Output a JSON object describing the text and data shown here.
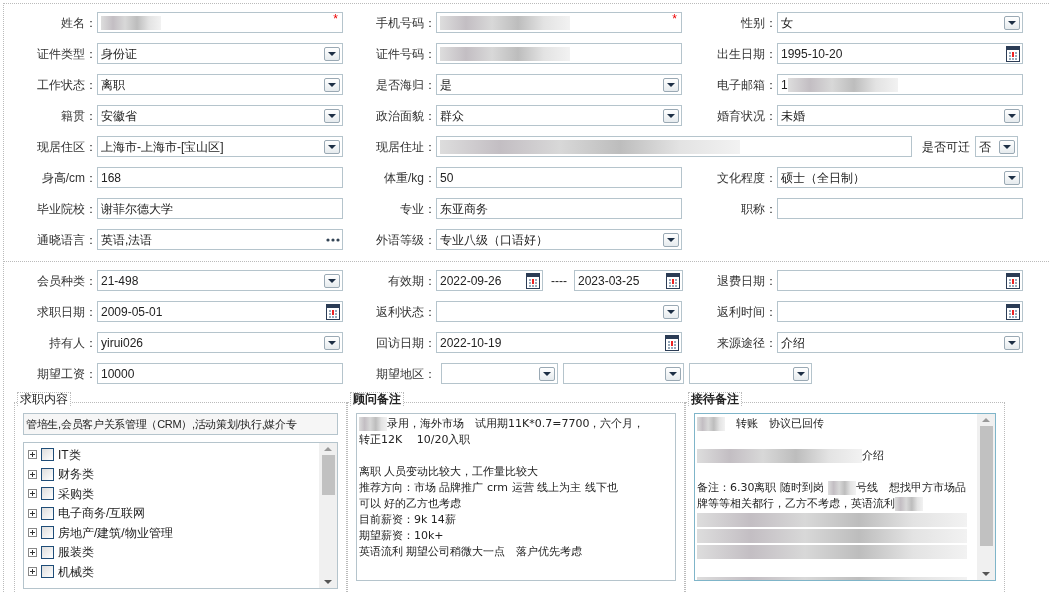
{
  "section_1": {
    "rows": [
      {
        "cells": [
          {
            "label": "姓名：",
            "kind": "text",
            "redacted": true,
            "required_mark": "*"
          },
          {
            "label": "手机号码：",
            "kind": "text",
            "redacted": true,
            "required_mark": "*"
          },
          {
            "label": "性别：",
            "kind": "select",
            "value": "女"
          }
        ]
      },
      {
        "cells": [
          {
            "label": "证件类型：",
            "kind": "select",
            "value": "身份证"
          },
          {
            "label": "证件号码：",
            "kind": "text",
            "redacted": true
          },
          {
            "label": "出生日期：",
            "kind": "date",
            "value": "1995-10-20"
          }
        ]
      },
      {
        "cells": [
          {
            "label": "工作状态：",
            "kind": "select",
            "value": "离职"
          },
          {
            "label": "是否海归：",
            "kind": "select",
            "value": "是"
          },
          {
            "label": "电子邮箱：",
            "kind": "text",
            "value": "1",
            "redacted": true
          }
        ]
      },
      {
        "cells": [
          {
            "label": "籍贯：",
            "kind": "select",
            "value": "安徽省"
          },
          {
            "label": "政治面貌：",
            "kind": "select",
            "value": "群众"
          },
          {
            "label": "婚育状况：",
            "kind": "select",
            "value": "未婚"
          }
        ]
      },
      {
        "cells": [
          {
            "label": "现居住区：",
            "kind": "select",
            "value": " 上海市-上海市-[宝山区]"
          },
          {
            "label": "现居住址：",
            "kind": "wide_text",
            "redacted": true,
            "extra": {
              "label": "是否可迁",
              "value": "否"
            }
          }
        ]
      },
      {
        "cells": [
          {
            "label": "身高/cm：",
            "kind": "text",
            "value": "168"
          },
          {
            "label": "体重/kg：",
            "kind": "text",
            "value": "50"
          },
          {
            "label": "文化程度：",
            "kind": "select",
            "value": "硕士（全日制）"
          }
        ]
      },
      {
        "cells": [
          {
            "label": "毕业院校：",
            "kind": "text",
            "value": "谢菲尔德大学"
          },
          {
            "label": "专业：",
            "kind": "text",
            "value": "东亚商务"
          },
          {
            "label": "职称：",
            "kind": "text"
          }
        ]
      },
      {
        "cells": [
          {
            "label": "通晓语言：",
            "kind": "picker",
            "value": "英语,法语"
          },
          {
            "label": "外语等级：",
            "kind": "select",
            "value": "专业八级（口语好）"
          }
        ]
      }
    ]
  },
  "section_2": {
    "rows": [
      {
        "cells": [
          {
            "label": "会员种类：",
            "kind": "select",
            "value": " 21-498"
          },
          {
            "label": "有效期：",
            "kind": "date_range",
            "values": [
              "2022-09-26",
              "2023-03-25"
            ],
            "separator": "----"
          },
          {
            "label": "退费日期：",
            "kind": "date"
          }
        ]
      },
      {
        "cells": [
          {
            "label": "求职日期：",
            "kind": "date",
            "value": "2009-05-01"
          },
          {
            "label": "返利状态：",
            "kind": "select"
          },
          {
            "label": "返利时间：",
            "kind": "date"
          }
        ]
      },
      {
        "cells": [
          {
            "label": "持有人：",
            "kind": "select",
            "value": "yirui026"
          },
          {
            "label": "回访日期：",
            "kind": "date",
            "value": "2022-10-19"
          },
          {
            "label": "来源途径：",
            "kind": "select",
            "value": "介绍"
          }
        ]
      },
      {
        "cells": [
          {
            "label": "期望工资：",
            "kind": "text",
            "value": "10000"
          },
          {
            "label": "期望地区：",
            "kind": "select_group",
            "selects": [
              {
                "kind": "select"
              },
              {
                "kind": "select"
              },
              {
                "kind": "select"
              }
            ]
          }
        ]
      }
    ]
  },
  "job_content": {
    "title": "求职内容",
    "summary": "管培生,会员客户关系管理（CRM）,活动策划/执行,媒介专",
    "tree": [
      {
        "label": "IT类",
        "checked": false
      },
      {
        "label": "财务类",
        "checked": false
      },
      {
        "label": "采购类",
        "checked": false
      },
      {
        "label": "电子商务/互联网",
        "checked": false
      },
      {
        "label": "房地产/建筑/物业管理",
        "checked": false
      },
      {
        "label": "服装类",
        "checked": false
      },
      {
        "label": "机械类",
        "checked": false
      }
    ]
  },
  "advisor_notes": {
    "title": "顾问备注",
    "lines": [
      {
        "kind": "text",
        "segments": [
          {
            "kind": "blurred"
          },
          {
            "kind": "text",
            "text": "录用，海外市场　试用期11K*0.7=7700，六个月，"
          }
        ]
      },
      {
        "kind": "text",
        "segments": [
          {
            "kind": "text",
            "text": "转正12K　 10/20入职"
          }
        ]
      },
      {
        "kind": "blank"
      },
      {
        "kind": "text",
        "segments": [
          {
            "kind": "text",
            "text": "离职 人员变动比较大，工作量比较大"
          }
        ]
      },
      {
        "kind": "text",
        "segments": [
          {
            "kind": "text",
            "text": "推荐方向：市场 品牌推广 crm 运营 线上为主 线下也"
          }
        ]
      },
      {
        "kind": "text",
        "segments": [
          {
            "kind": "text",
            "text": "可以 好的乙方也考虑"
          }
        ]
      },
      {
        "kind": "text",
        "segments": [
          {
            "kind": "text",
            "text": "目前薪资：9k 14薪"
          }
        ]
      },
      {
        "kind": "text",
        "segments": [
          {
            "kind": "text",
            "text": "期望薪资：10k+"
          }
        ]
      },
      {
        "kind": "text",
        "segments": [
          {
            "kind": "text",
            "text": "英语流利 期望公司稍微大一点　落户优先考虑"
          }
        ]
      }
    ]
  },
  "reception_notes": {
    "title": "接待备注",
    "lines": [
      {
        "kind": "text",
        "segments": [
          {
            "kind": "blurred"
          },
          {
            "kind": "text",
            "text": "　转账　协议已回传"
          }
        ]
      },
      {
        "kind": "blank"
      },
      {
        "kind": "text",
        "segments": [
          {
            "kind": "blurred_long"
          },
          {
            "kind": "text",
            "text": "介绍"
          }
        ]
      },
      {
        "kind": "blank"
      },
      {
        "kind": "text",
        "segments": [
          {
            "kind": "text",
            "text": "备注：6.30离职 随时到岗 "
          },
          {
            "kind": "blurred"
          },
          {
            "kind": "text",
            "text": "号线　想找甲方市场品"
          }
        ]
      },
      {
        "kind": "text",
        "segments": [
          {
            "kind": "text",
            "text": "牌等等相关都行，乙方不考虑，英语流利"
          },
          {
            "kind": "blurred"
          }
        ]
      },
      {
        "kind": "blurred_line"
      },
      {
        "kind": "blurred_line"
      },
      {
        "kind": "blurred_line"
      },
      {
        "kind": "blank"
      },
      {
        "kind": "blurred_line"
      }
    ]
  }
}
